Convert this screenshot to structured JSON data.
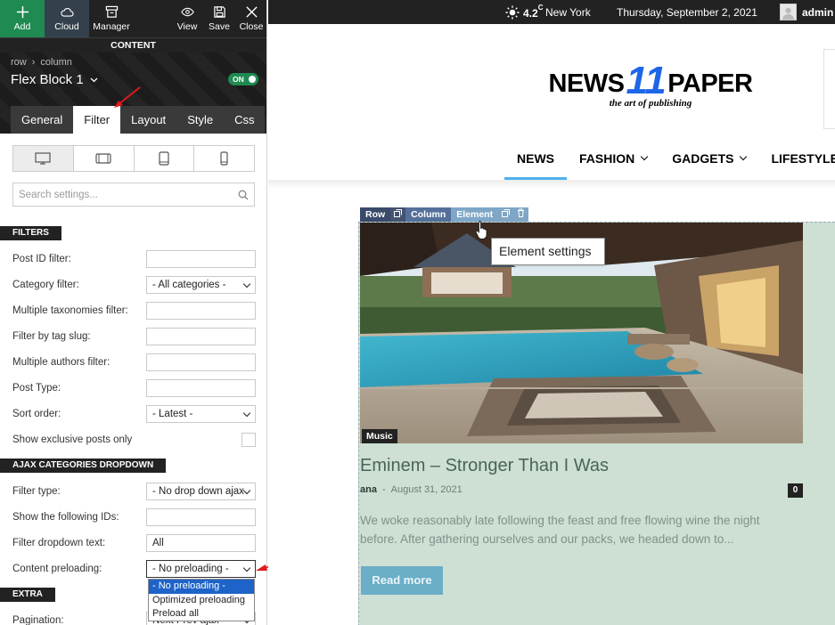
{
  "toolbar": {
    "add_label": "Add",
    "cloud_label": "Cloud",
    "manager_label": "Manager",
    "view_label": "View",
    "save_label": "Save",
    "close_label": "Close",
    "add_bg": "#1f8a52",
    "cloud_bg": "#34414d"
  },
  "panel": {
    "content_label": "CONTENT",
    "breadcrumb": [
      "row",
      "column"
    ],
    "title": "Flex Block 1",
    "toggle_label": "ON",
    "tabs": [
      "General",
      "Filter",
      "Layout",
      "Style",
      "Css"
    ],
    "active_tab": "Filter",
    "devices": [
      "desktop",
      "tablet-landscape",
      "tablet-portrait",
      "phone"
    ],
    "search_placeholder": "Search settings...",
    "sections": {
      "filters": "FILTERS",
      "ajax": "AJAX CATEGORIES DROPDOWN",
      "extra": "EXTRA"
    },
    "filters": [
      {
        "label": "Post ID filter:",
        "value": ""
      },
      {
        "label": "Category filter:",
        "value": "- All categories -"
      },
      {
        "label": "Multiple taxonomies filter:",
        "value": ""
      },
      {
        "label": "Filter by tag slug:",
        "value": ""
      },
      {
        "label": "Multiple authors filter:",
        "value": ""
      },
      {
        "label": "Post Type:",
        "value": ""
      },
      {
        "label": "Sort order:",
        "value": "- Latest -"
      },
      {
        "label": "Show exclusive posts only",
        "value": ""
      }
    ],
    "ajax": [
      {
        "label": "Filter type:",
        "value": "- No drop down ajax"
      },
      {
        "label": "Show the following IDs:",
        "value": ""
      },
      {
        "label": "Filter dropdown text:",
        "value": "All"
      },
      {
        "label": "Content preloading:",
        "value": "- No preloading -"
      }
    ],
    "extra": [
      {
        "label": "Pagination:",
        "value": "Next Prev ajax"
      }
    ],
    "preload_options": [
      "- No preloading -",
      "Optimized preloading",
      "Preload all"
    ],
    "preload_selected": "- No preloading -"
  },
  "site": {
    "weather_temp": "4.2",
    "weather_unit": "C",
    "city": "New York",
    "date": "Thursday, September 2, 2021",
    "user": "admin",
    "logo_left": "NEWS",
    "logo_num": "11",
    "logo_right": "PAPER",
    "tagline": "the art of publishing",
    "logo_accent": "#1e66e8",
    "nav": [
      {
        "label": "NEWS",
        "dropdown": false
      },
      {
        "label": "FASHION",
        "dropdown": true
      },
      {
        "label": "GADGETS",
        "dropdown": true
      },
      {
        "label": "LIFESTYLE",
        "dropdown": true
      }
    ],
    "nav_accent": "#4db2ec",
    "builder_bar": {
      "row": "Row",
      "column": "Column",
      "element": "Element"
    },
    "tooltip": "Element settings",
    "post": {
      "category": "Music",
      "title": "Eminem – Stronger Than I Was",
      "author": "ana",
      "separator": "-",
      "date": "August 31, 2021",
      "comments": "0",
      "excerpt": "We woke reasonably late following the feast and free flowing wine the night before. After gathering ourselves and our packs, we headed down to...",
      "read_more": "Read more"
    },
    "highlight_bg": "#cde0d3"
  }
}
